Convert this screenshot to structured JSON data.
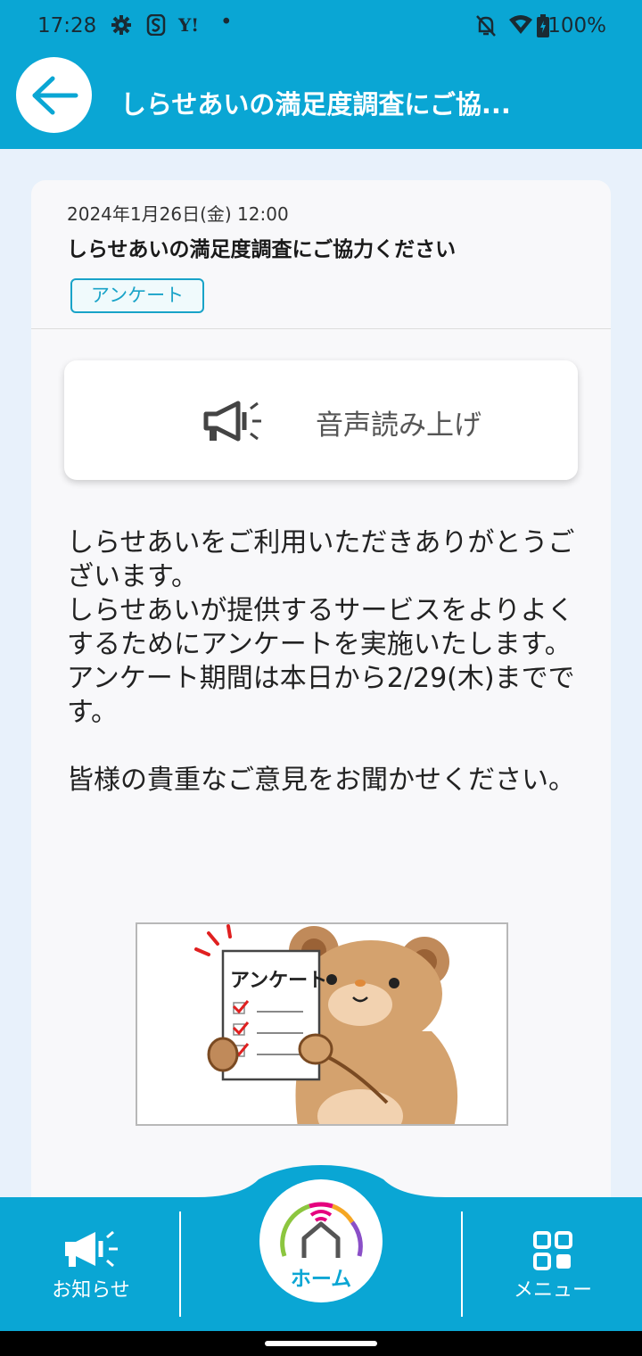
{
  "status_bar": {
    "time": "17:28",
    "battery": "100%",
    "icons": [
      "gear-icon",
      "s-app-icon",
      "yahoo-icon",
      "dot-icon",
      "bell-off-icon",
      "wifi-icon",
      "battery-icon"
    ]
  },
  "app_bar": {
    "title": "しらせあいの満足度調査にご協..."
  },
  "notice": {
    "date": "2024年1月26日(金) 12:00",
    "title": "しらせあいの満足度調査にご協力ください",
    "tag": "アンケート"
  },
  "tts": {
    "label": "音声読み上げ"
  },
  "body": {
    "paragraph1": "しらせあいをご利用いただきありがとうございます。",
    "paragraph2": "しらせあいが提供するサービスをよりよくするためにアンケートを実施いたします。",
    "paragraph3": "アンケート期間は本日から2/29(木)までです。",
    "paragraph4": "皆様の貴重なご意見をお聞かせください。"
  },
  "illustration": {
    "sheet_title": "アンケート"
  },
  "bottom_nav": {
    "notices_label": "お知らせ",
    "home_label": "ホーム",
    "menu_label": "メニュー"
  },
  "colors": {
    "primary": "#0aa6d4",
    "background": "#e8f1fb",
    "card": "#f8f8fa"
  }
}
